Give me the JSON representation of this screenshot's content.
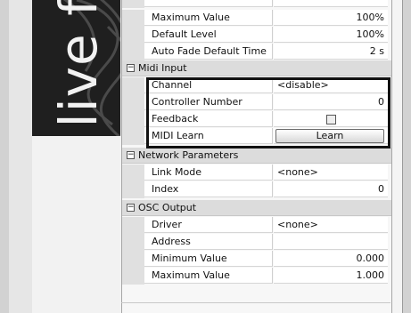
{
  "logo": {
    "text": "live f"
  },
  "top_rows": [
    {
      "label": "Maximum Value",
      "value": "100%"
    },
    {
      "label": "Default Level",
      "value": "100%"
    },
    {
      "label": "Auto Fade Default Time",
      "value": "2 s"
    }
  ],
  "sections": {
    "midi_input": {
      "title": "Midi Input",
      "rows": [
        {
          "label": "Channel",
          "value": "<disable>"
        },
        {
          "label": "Controller Number",
          "value": "0"
        },
        {
          "label": "Feedback",
          "checked": false
        },
        {
          "label": "MIDI Learn",
          "button": "Learn"
        }
      ]
    },
    "network_parameters": {
      "title": "Network Parameters",
      "rows": [
        {
          "label": "Link Mode",
          "value": "<none>"
        },
        {
          "label": "Index",
          "value": "0"
        }
      ]
    },
    "osc_output": {
      "title": "OSC Output",
      "rows": [
        {
          "label": "Driver",
          "value": "<none>"
        },
        {
          "label": "Address",
          "value": ""
        },
        {
          "label": "Minimum Value",
          "value": "0.000"
        },
        {
          "label": "Maximum Value",
          "value": "1.000"
        }
      ]
    }
  },
  "colors": {
    "highlight": "#111111",
    "category_bg": "#dcdcdc"
  }
}
